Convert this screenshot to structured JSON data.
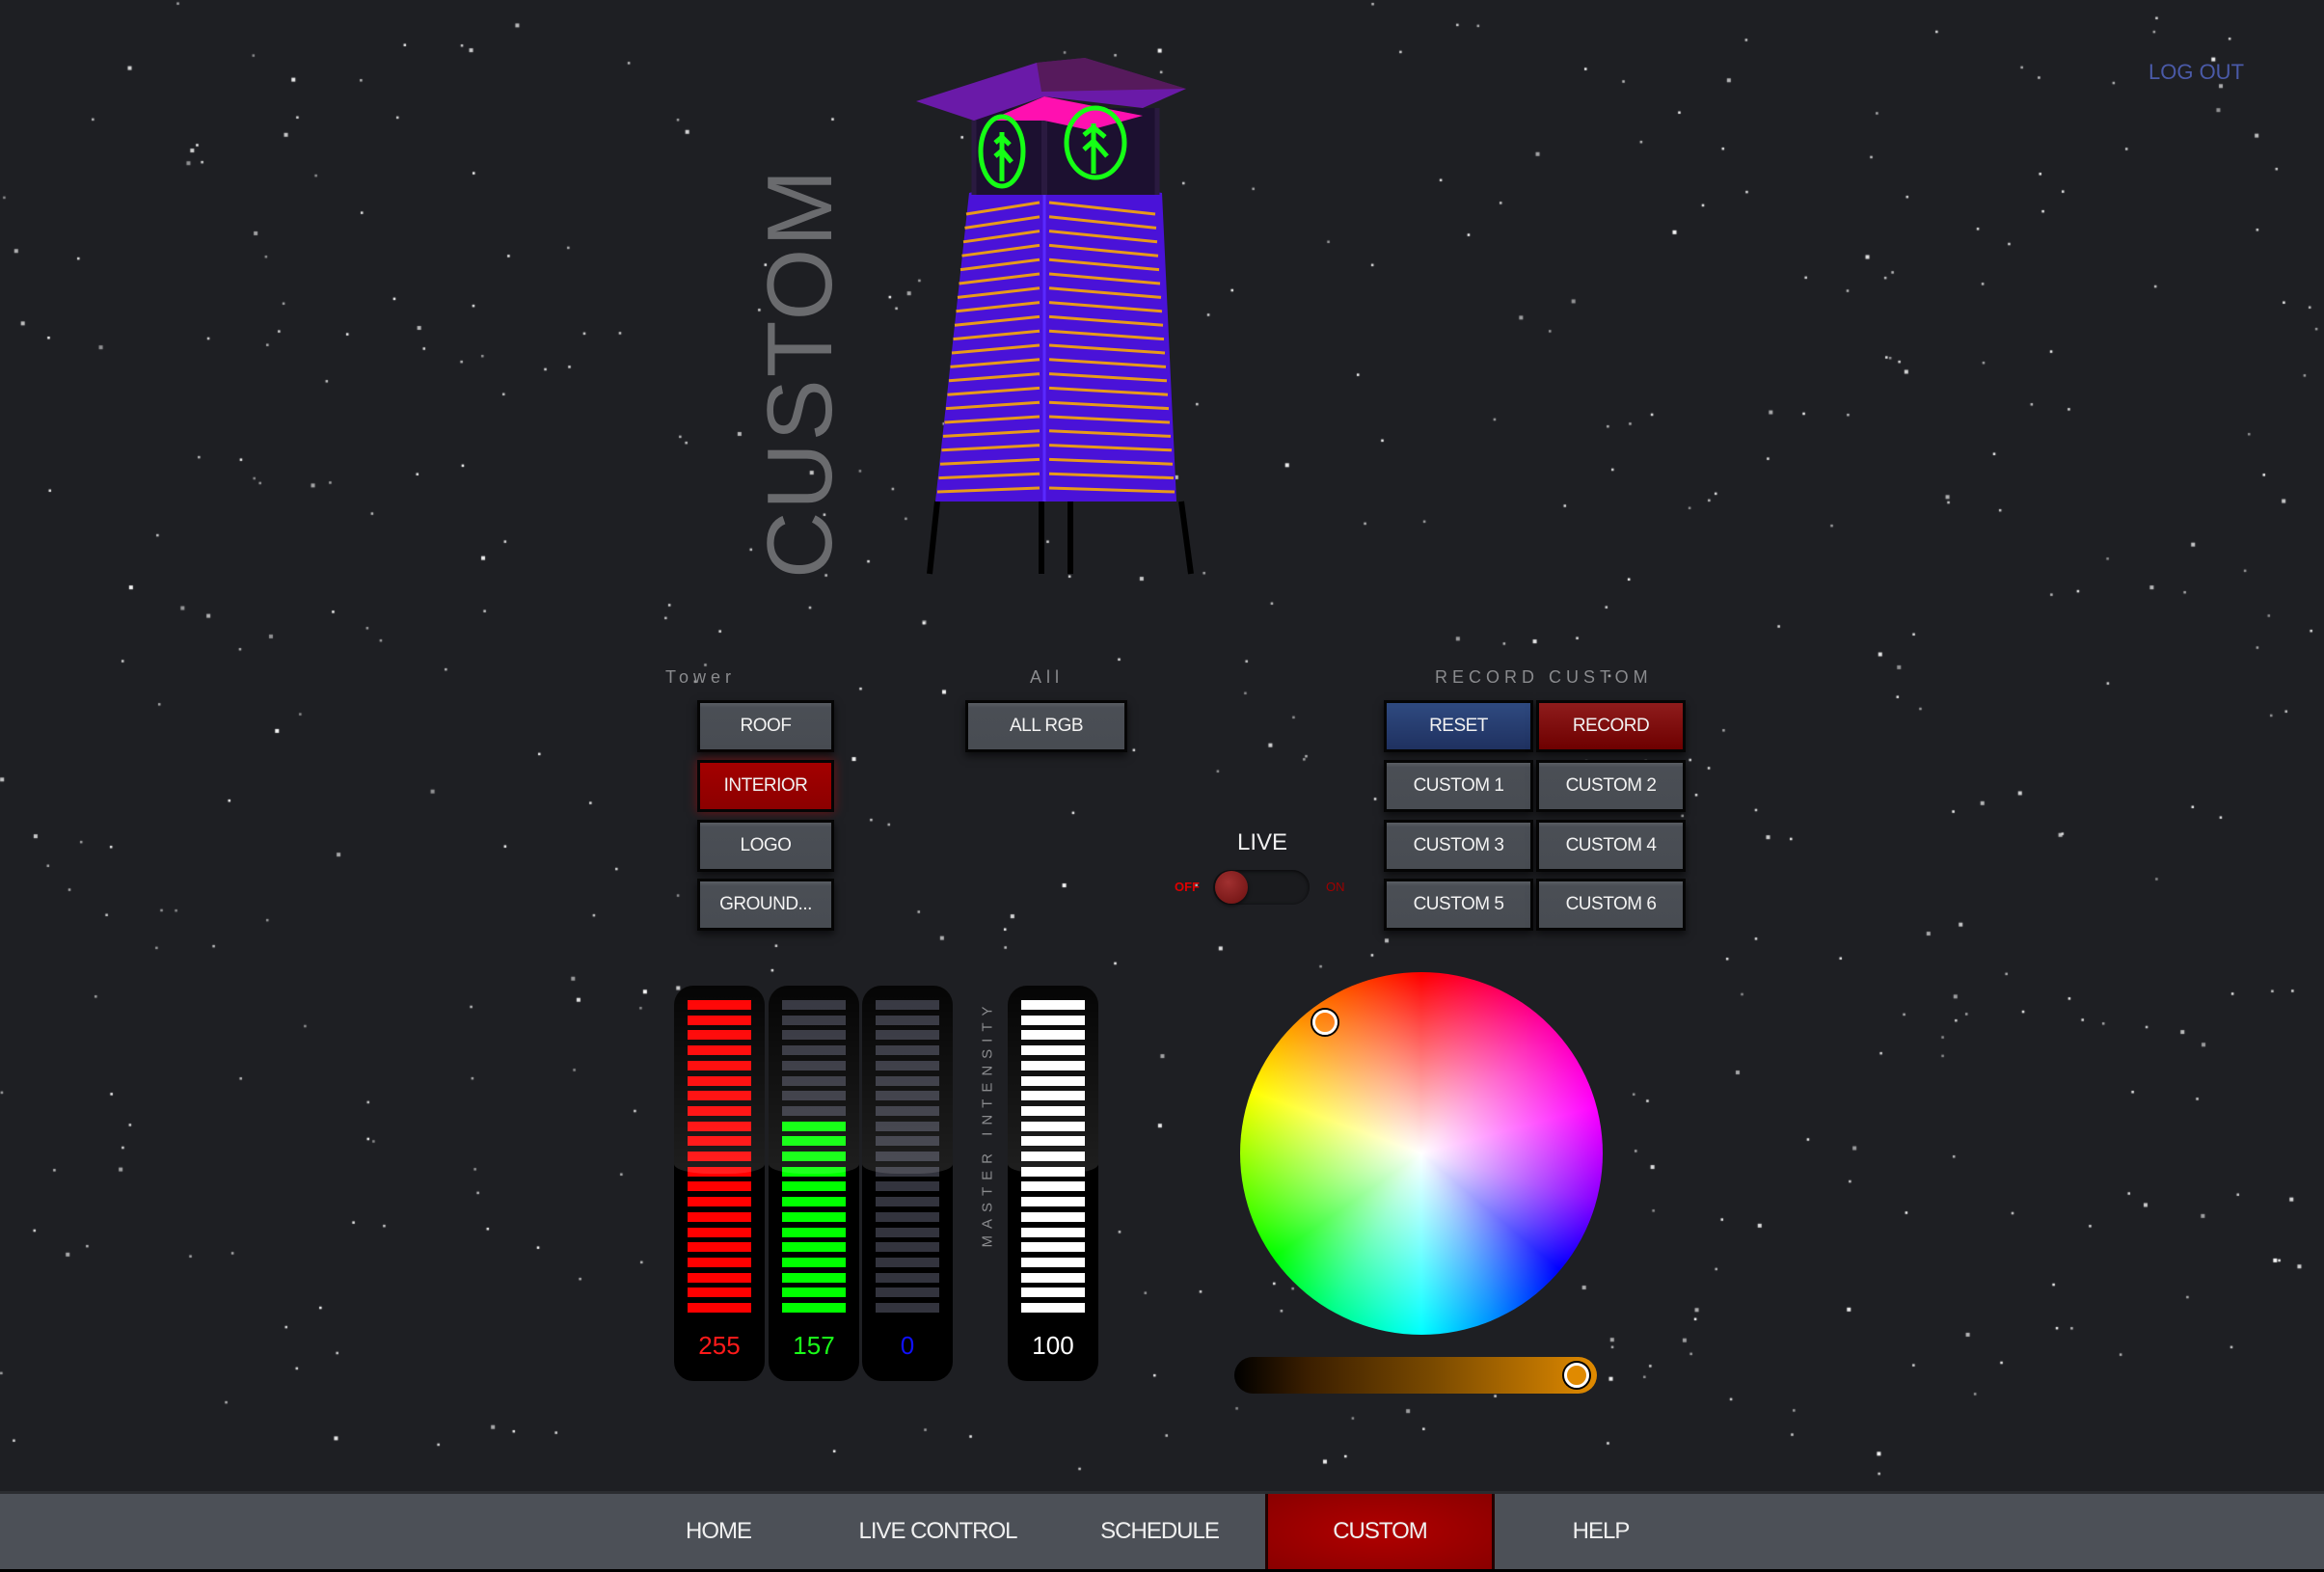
{
  "header": {
    "logout_label": "LOG OUT",
    "page_title": "CUSTOM"
  },
  "tower_group": {
    "label": "Tower",
    "buttons": [
      {
        "label": "ROOF",
        "active": false
      },
      {
        "label": "INTERIOR",
        "active": true
      },
      {
        "label": "LOGO",
        "active": false
      },
      {
        "label": "GROUND...",
        "active": false
      }
    ]
  },
  "all_group": {
    "label": "All",
    "button_label": "ALL RGB"
  },
  "record_group": {
    "label": "RECORD CUSTOM",
    "reset_label": "RESET",
    "record_label": "RECORD",
    "customs": [
      "CUSTOM 1",
      "CUSTOM 2",
      "CUSTOM 3",
      "CUSTOM 4",
      "CUSTOM 5",
      "CUSTOM 6"
    ]
  },
  "live": {
    "label": "LIVE",
    "off_label": "OFF",
    "on_label": "ON",
    "state": "off"
  },
  "sliders": {
    "red": {
      "value": "255",
      "max": 255,
      "color": "#ff0000"
    },
    "green": {
      "value": "157",
      "max": 255,
      "color": "#00ff00"
    },
    "blue": {
      "value": "0",
      "max": 255,
      "color": "#0000ff"
    },
    "master": {
      "label": "MASTER INTENSITY",
      "value": "100",
      "max": 100,
      "color": "#ffffff"
    }
  },
  "color_picker": {
    "selected_hex": "#ff9d00",
    "brightness_percent": 100
  },
  "nav": {
    "items": [
      {
        "label": "HOME",
        "active": false
      },
      {
        "label": "LIVE CONTROL",
        "active": false
      },
      {
        "label": "SCHEDULE",
        "active": false
      },
      {
        "label": "CUSTOM",
        "active": true
      },
      {
        "label": "HELP",
        "active": false
      }
    ]
  },
  "colors": {
    "accent_red": "#a30000",
    "reset_blue": "#2f4a80",
    "logout": "#4a5aa8"
  }
}
